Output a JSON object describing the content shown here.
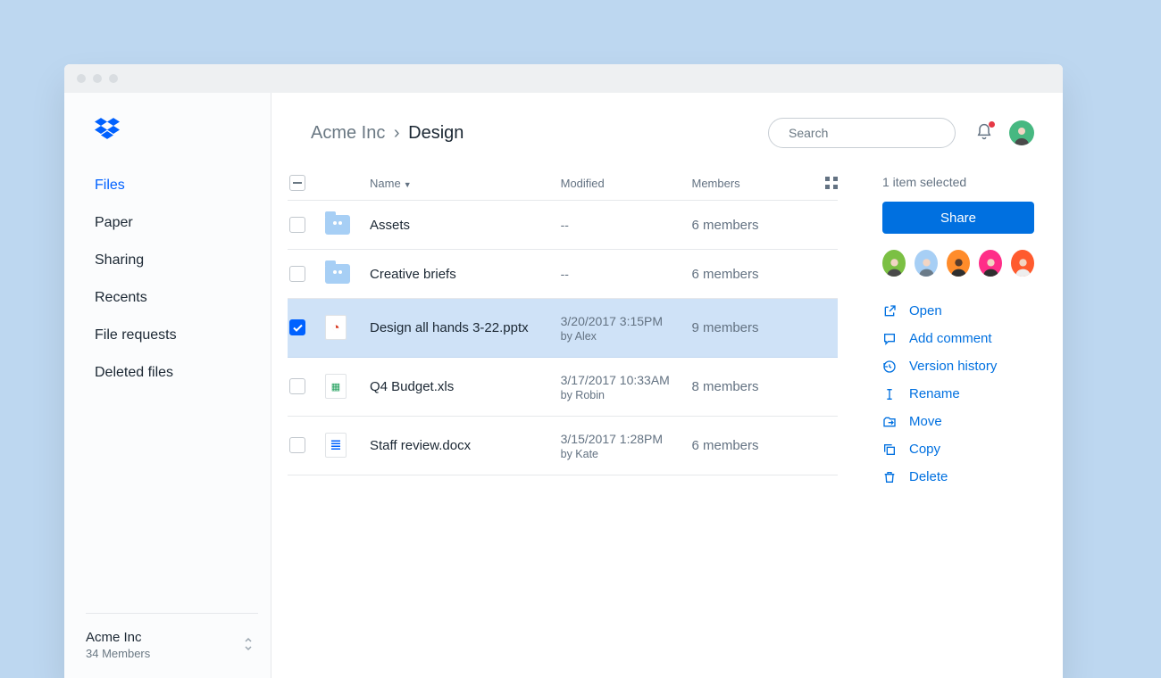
{
  "sidebar": {
    "items": [
      {
        "label": "Files",
        "active": true
      },
      {
        "label": "Paper"
      },
      {
        "label": "Sharing"
      },
      {
        "label": "Recents"
      },
      {
        "label": "File requests"
      },
      {
        "label": "Deleted files"
      }
    ],
    "org": {
      "name": "Acme Inc",
      "members": "34 Members"
    }
  },
  "header": {
    "breadcrumb": {
      "parent": "Acme Inc",
      "sep": "›",
      "current": "Design"
    },
    "search_placeholder": "Search"
  },
  "table": {
    "columns": {
      "name": "Name",
      "modified": "Modified",
      "members": "Members"
    },
    "rows": [
      {
        "type": "folder",
        "name": "Assets",
        "modified": "--",
        "by": "",
        "members": "6 members",
        "selected": false
      },
      {
        "type": "folder",
        "name": "Creative briefs",
        "modified": "--",
        "by": "",
        "members": "6 members",
        "selected": false
      },
      {
        "type": "pptx",
        "name": "Design all hands 3-22.pptx",
        "modified": "3/20/2017 3:15PM",
        "by": "by Alex",
        "members": "9 members",
        "selected": true
      },
      {
        "type": "xls",
        "name": "Q4 Budget.xls",
        "modified": "3/17/2017 10:33AM",
        "by": "by Robin",
        "members": "8 members",
        "selected": false
      },
      {
        "type": "docx",
        "name": "Staff review.docx",
        "modified": "3/15/2017 1:28PM",
        "by": "by Kate",
        "members": "6 members",
        "selected": false
      }
    ]
  },
  "panel": {
    "selected": "1 item selected",
    "share": "Share",
    "avatar_colors": [
      "#7bc043",
      "#a7cff5",
      "#ff8c2b",
      "#ff2e88",
      "#ff5b2e"
    ],
    "actions": [
      {
        "icon": "open",
        "label": "Open"
      },
      {
        "icon": "comment",
        "label": "Add comment"
      },
      {
        "icon": "history",
        "label": "Version history"
      },
      {
        "icon": "rename",
        "label": "Rename"
      },
      {
        "icon": "move",
        "label": "Move"
      },
      {
        "icon": "copy",
        "label": "Copy"
      },
      {
        "icon": "delete",
        "label": "Delete"
      }
    ]
  }
}
